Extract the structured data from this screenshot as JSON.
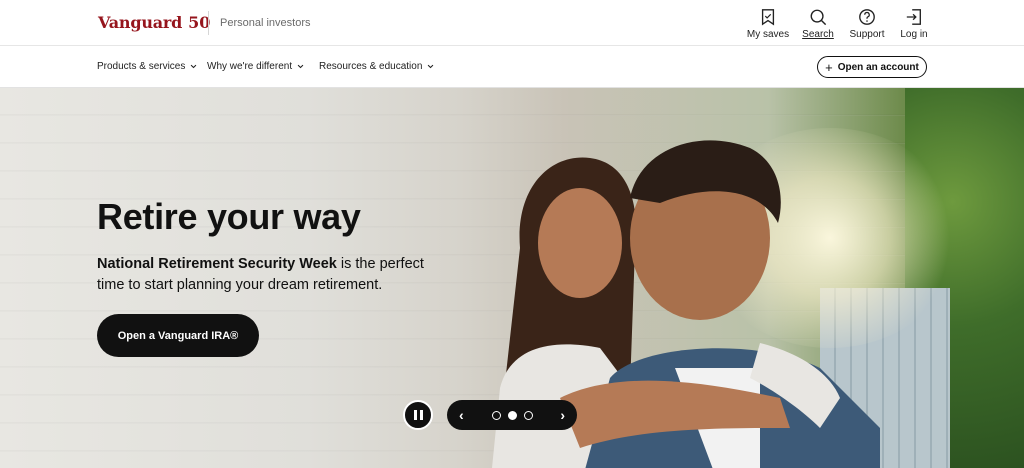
{
  "brand": {
    "name": "Vanguard",
    "anniversary": "50",
    "segment": "Personal investors",
    "color": "#96151d"
  },
  "utility_nav": [
    {
      "label": "My saves",
      "icon": "bookmark-icon"
    },
    {
      "label": "Search",
      "icon": "search-icon"
    },
    {
      "label": "Support",
      "icon": "question-circle-icon"
    },
    {
      "label": "Log in",
      "icon": "login-icon"
    }
  ],
  "main_nav": [
    {
      "label": "Products & services"
    },
    {
      "label": "Why we're different"
    },
    {
      "label": "Resources & education"
    }
  ],
  "open_account": {
    "label": "Open an account"
  },
  "hero": {
    "title": "Retire your way",
    "body_bold": "National Retirement Security Week",
    "body_rest": " is the perfect time to start planning your dream retirement.",
    "cta": "Open a Vanguard IRA®"
  },
  "carousel": {
    "slides": 3,
    "active": 2,
    "prev": "‹",
    "next": "›"
  }
}
